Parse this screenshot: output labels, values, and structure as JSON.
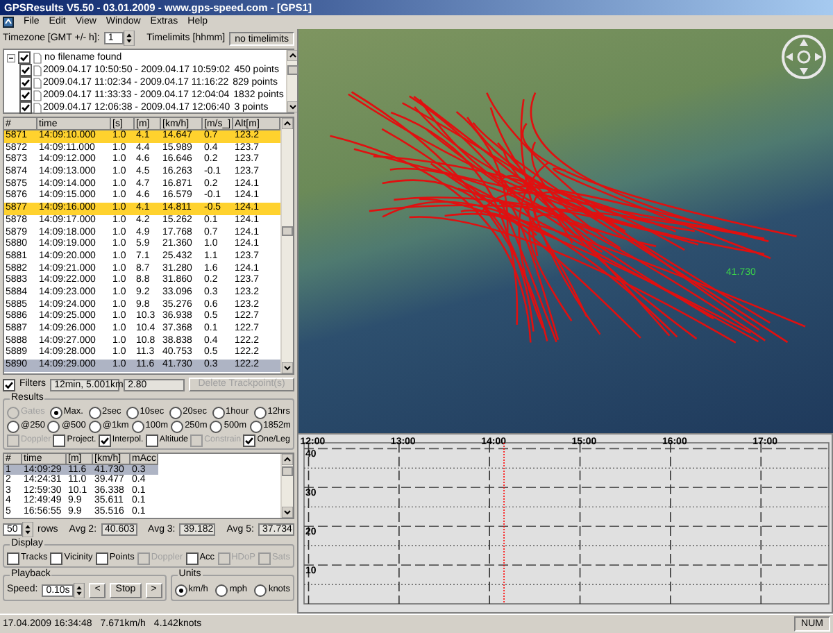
{
  "window": {
    "title": "GPSResults V5.50 - 03.01.2009 - www.gps-speed.com - [GPS1]"
  },
  "menu": [
    "File",
    "Edit",
    "View",
    "Window",
    "Extras",
    "Help"
  ],
  "timezone": {
    "label": "Timezone [GMT +/- h]:",
    "value": "1",
    "timelimits_label": "Timelimits [hhmm]",
    "timelimits_button": "no timelimits"
  },
  "files": {
    "label": "no filename found",
    "checked": true,
    "expanded": true,
    "children": [
      {
        "label": "2009.04.17 10:50:50 - 2009.04.17 10:59:02",
        "points": "450 points",
        "checked": true
      },
      {
        "label": "2009.04.17 11:02:34 - 2009.04.17 11:16:22",
        "points": "829 points",
        "checked": true
      },
      {
        "label": "2009.04.17 11:33:33 - 2009.04.17 12:04:04",
        "points": "1832 points",
        "checked": true
      },
      {
        "label": "2009.04.17 12:06:38 - 2009.04.17 12:06:40",
        "points": "3 points",
        "checked": true
      }
    ]
  },
  "trackpoints": {
    "columns": [
      "#",
      "time",
      "[s]",
      "[m]",
      "[km/h]",
      "[m/s_]",
      "Alt[m]"
    ],
    "rows": [
      {
        "cells": [
          "5871",
          "14:09:10.000",
          "1.0",
          "4.1",
          "14.647",
          "0.7",
          "123.2"
        ],
        "highlighted": true,
        "selected": false
      },
      {
        "cells": [
          "5872",
          "14:09:11.000",
          "1.0",
          "4.4",
          "15.989",
          "0.4",
          "123.7"
        ],
        "highlighted": false,
        "selected": false
      },
      {
        "cells": [
          "5873",
          "14:09:12.000",
          "1.0",
          "4.6",
          "16.646",
          "0.2",
          "123.7"
        ],
        "highlighted": false,
        "selected": false
      },
      {
        "cells": [
          "5874",
          "14:09:13.000",
          "1.0",
          "4.5",
          "16.263",
          "-0.1",
          "123.7"
        ],
        "highlighted": false,
        "selected": false
      },
      {
        "cells": [
          "5875",
          "14:09:14.000",
          "1.0",
          "4.7",
          "16.871",
          "0.2",
          "124.1"
        ],
        "highlighted": false,
        "selected": false
      },
      {
        "cells": [
          "5876",
          "14:09:15.000",
          "1.0",
          "4.6",
          "16.579",
          "-0.1",
          "124.1"
        ],
        "highlighted": false,
        "selected": false
      },
      {
        "cells": [
          "5877",
          "14:09:16.000",
          "1.0",
          "4.1",
          "14.811",
          "-0.5",
          "124.1"
        ],
        "highlighted": true,
        "selected": false
      },
      {
        "cells": [
          "5878",
          "14:09:17.000",
          "1.0",
          "4.2",
          "15.262",
          "0.1",
          "124.1"
        ],
        "highlighted": false,
        "selected": false
      },
      {
        "cells": [
          "5879",
          "14:09:18.000",
          "1.0",
          "4.9",
          "17.768",
          "0.7",
          "124.1"
        ],
        "highlighted": false,
        "selected": false
      },
      {
        "cells": [
          "5880",
          "14:09:19.000",
          "1.0",
          "5.9",
          "21.360",
          "1.0",
          "124.1"
        ],
        "highlighted": false,
        "selected": false
      },
      {
        "cells": [
          "5881",
          "14:09:20.000",
          "1.0",
          "7.1",
          "25.432",
          "1.1",
          "123.7"
        ],
        "highlighted": false,
        "selected": false
      },
      {
        "cells": [
          "5882",
          "14:09:21.000",
          "1.0",
          "8.7",
          "31.280",
          "1.6",
          "124.1"
        ],
        "highlighted": false,
        "selected": false
      },
      {
        "cells": [
          "5883",
          "14:09:22.000",
          "1.0",
          "8.8",
          "31.860",
          "0.2",
          "123.7"
        ],
        "highlighted": false,
        "selected": false
      },
      {
        "cells": [
          "5884",
          "14:09:23.000",
          "1.0",
          "9.2",
          "33.096",
          "0.3",
          "123.2"
        ],
        "highlighted": false,
        "selected": false
      },
      {
        "cells": [
          "5885",
          "14:09:24.000",
          "1.0",
          "9.8",
          "35.276",
          "0.6",
          "123.2"
        ],
        "highlighted": false,
        "selected": false
      },
      {
        "cells": [
          "5886",
          "14:09:25.000",
          "1.0",
          "10.3",
          "36.938",
          "0.5",
          "122.7"
        ],
        "highlighted": false,
        "selected": false
      },
      {
        "cells": [
          "5887",
          "14:09:26.000",
          "1.0",
          "10.4",
          "37.368",
          "0.1",
          "122.7"
        ],
        "highlighted": false,
        "selected": false
      },
      {
        "cells": [
          "5888",
          "14:09:27.000",
          "1.0",
          "10.8",
          "38.838",
          "0.4",
          "122.2"
        ],
        "highlighted": false,
        "selected": false
      },
      {
        "cells": [
          "5889",
          "14:09:28.000",
          "1.0",
          "11.3",
          "40.753",
          "0.5",
          "122.2"
        ],
        "highlighted": false,
        "selected": false
      },
      {
        "cells": [
          "5890",
          "14:09:29.000",
          "1.0",
          "11.6",
          "41.730",
          "0.3",
          "122.2"
        ],
        "highlighted": false,
        "selected": true
      }
    ]
  },
  "filters": {
    "label": "Filters",
    "checked": true,
    "value": "12min, 5.001km",
    "value_2": "2.80",
    "delete_button": {
      "label": "Delete Trackpoint(s)",
      "disabled": true
    }
  },
  "results": {
    "title": "Results",
    "option_rows": [
      [
        {
          "label": "Gates",
          "selected": false,
          "disabled": true
        },
        {
          "label": "Max.",
          "selected": true,
          "disabled": false
        },
        {
          "label": "2sec",
          "selected": false,
          "disabled": false
        },
        {
          "label": "10sec",
          "selected": false,
          "disabled": false
        },
        {
          "label": "20sec",
          "selected": false,
          "disabled": false
        },
        {
          "label": "1hour",
          "selected": false,
          "disabled": false
        },
        {
          "label": "12hrs",
          "selected": false,
          "disabled": false
        }
      ],
      [
        {
          "label": "@250",
          "selected": false,
          "disabled": false
        },
        {
          "label": "@500",
          "selected": false,
          "disabled": false
        },
        {
          "label": "@1km",
          "selected": false,
          "disabled": false
        },
        {
          "label": "100m",
          "selected": false,
          "disabled": false
        },
        {
          "label": "250m",
          "selected": false,
          "disabled": false
        },
        {
          "label": "500m",
          "selected": false,
          "disabled": false
        },
        {
          "label": "1852m",
          "selected": false,
          "disabled": false
        }
      ]
    ],
    "checkboxes": [
      {
        "label": "Doppler",
        "checked": false,
        "disabled": true
      },
      {
        "label": "Project.",
        "checked": false,
        "disabled": false
      },
      {
        "label": "Interpol.",
        "checked": true,
        "disabled": false
      },
      {
        "label": "Altitude",
        "checked": false,
        "disabled": false
      },
      {
        "label": "Constrain",
        "checked": false,
        "disabled": true
      },
      {
        "label": "One/Leg",
        "checked": true,
        "disabled": false
      }
    ],
    "table": {
      "columns": [
        "#",
        "time",
        "[m]",
        "[km/h]",
        "mAcc"
      ],
      "rows": [
        {
          "cells": [
            "1",
            "14:09:29",
            "11.6",
            "41.730",
            "0.3"
          ],
          "selected": true
        },
        {
          "cells": [
            "2",
            "14:24:31",
            "11.0",
            "39.477",
            "0.4"
          ],
          "selected": false
        },
        {
          "cells": [
            "3",
            "12:59:30",
            "10.1",
            "36.338",
            "0.1"
          ],
          "selected": false
        },
        {
          "cells": [
            "4",
            "12:49:49",
            "9.9",
            "35.611",
            "0.1"
          ],
          "selected": false
        },
        {
          "cells": [
            "5",
            "16:56:55",
            "9.9",
            "35.516",
            "0.1"
          ],
          "selected": false
        }
      ]
    },
    "rows_count": "50",
    "rows_label": "rows",
    "averages": [
      {
        "label": "Avg 2:",
        "value": "40.603"
      },
      {
        "label": "Avg 3:",
        "value": "39.182"
      },
      {
        "label": "Avg 5:",
        "value": "37.734"
      }
    ]
  },
  "display": {
    "title": "Display",
    "options": [
      {
        "label": "Tracks",
        "checked": false,
        "disabled": false
      },
      {
        "label": "Vicinity",
        "checked": false,
        "disabled": false
      },
      {
        "label": "Points",
        "checked": false,
        "disabled": false
      },
      {
        "label": "Doppler",
        "checked": false,
        "disabled": true
      },
      {
        "label": "Acc",
        "checked": false,
        "disabled": false
      },
      {
        "label": "HDoP",
        "checked": false,
        "disabled": true
      },
      {
        "label": "Sats",
        "checked": false,
        "disabled": true
      }
    ]
  },
  "playback": {
    "title": "Playback",
    "speed_label": "Speed:",
    "speed": "0.10s",
    "buttons": [
      "<",
      "Stop",
      ">"
    ]
  },
  "units": {
    "title": "Units",
    "options": [
      {
        "label": "km/h",
        "selected": true
      },
      {
        "label": "mph",
        "selected": false
      },
      {
        "label": "knots",
        "selected": false
      }
    ]
  },
  "map": {
    "speed_label": "41.730"
  },
  "chart": {
    "chart_data": {
      "type": "line",
      "xlim": [
        11.95,
        17.75
      ],
      "ylim": [
        0,
        41.5
      ],
      "xticks": [
        {
          "value": 12,
          "label": "12:00"
        },
        {
          "value": 13,
          "label": "13:00"
        },
        {
          "value": 14,
          "label": "14:00"
        },
        {
          "value": 15,
          "label": "15:00"
        },
        {
          "value": 16,
          "label": "16:00"
        },
        {
          "value": 17,
          "label": "17:00"
        }
      ],
      "yticks": [
        10,
        20,
        30,
        40
      ],
      "grid": true,
      "ref_lines": [
        {
          "axis": "x",
          "value": 14.16
        }
      ]
    }
  },
  "status_bar": {
    "date_time": "17.04.2009 16:34:48",
    "speed_kmh": "7.671km/h",
    "speed_knots": "4.142knots",
    "indicator": "NUM"
  }
}
